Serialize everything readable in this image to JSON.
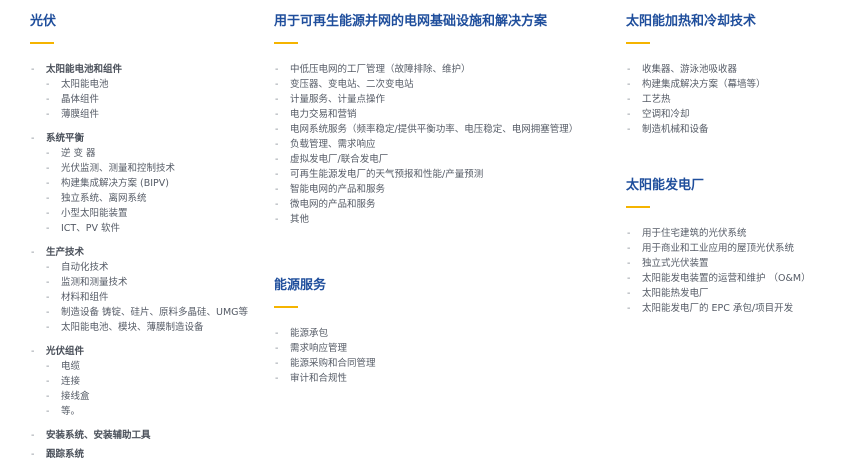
{
  "pv": {
    "title": "光伏",
    "groups": [
      {
        "label": "太阳能电池和组件",
        "items": [
          "太阳能电池",
          "晶体组件",
          "薄膜组件"
        ]
      },
      {
        "label": "系统平衡",
        "items": [
          "逆 变 器",
          "光伏监测、测量和控制技术",
          "构建集成解决方案 (BIPV)",
          "独立系统、离网系统",
          "小型太阳能装置",
          "ICT、PV 软件"
        ]
      },
      {
        "label": "生产技术",
        "items": [
          "自动化技术",
          "监测和测量技术",
          "材料和组件",
          "制造设备 铸锭、硅片、原料多晶硅、UMG等",
          "太阳能电池、模块、薄膜制造设备"
        ]
      },
      {
        "label": "光伏组件",
        "items": [
          "电缆",
          "连接",
          "接线盒",
          "等。"
        ]
      },
      {
        "label": "安装系统、安装辅助工具",
        "items": []
      },
      {
        "label": "跟踪系统",
        "items": []
      }
    ]
  },
  "grid": {
    "title": "用于可再生能源并网的电网基础设施和解决方案",
    "items": [
      "中低压电网的工厂管理（故障排除、维护）",
      "变压器、变电站、二次变电站",
      "计量服务、计量点操作",
      "电力交易和营销",
      "电网系统服务（频率稳定/提供平衡功率、电压稳定、电网拥塞管理）",
      "负载管理、需求响应",
      "虚拟发电厂/联合发电厂",
      "可再生能源发电厂的天气预报和性能/产量预测",
      "智能电网的产品和服务",
      "微电网的产品和服务",
      "其他"
    ]
  },
  "energy": {
    "title": "能源服务",
    "items": [
      "能源承包",
      "需求响应管理",
      "能源采购和合同管理",
      "审计和合规性"
    ]
  },
  "thermal": {
    "title": "太阳能加热和冷却技术",
    "items": [
      "收集器、游泳池吸收器",
      "构建集成解决方案（幕墙等）",
      "工艺热",
      "空调和冷却",
      "制造机械和设备"
    ]
  },
  "plant": {
    "title": "太阳能发电厂",
    "items": [
      "用于住宅建筑的光伏系统",
      "用于商业和工业应用的屋顶光伏系统",
      "独立式光伏装置",
      "太阳能发电装置的运营和维护 （O&M）",
      "太阳能热发电厂",
      "太阳能发电厂的 EPC 承包/项目开发"
    ]
  },
  "colors": {
    "title": "#1f4e9c",
    "accent": "#f5b400",
    "text": "#555b66"
  }
}
